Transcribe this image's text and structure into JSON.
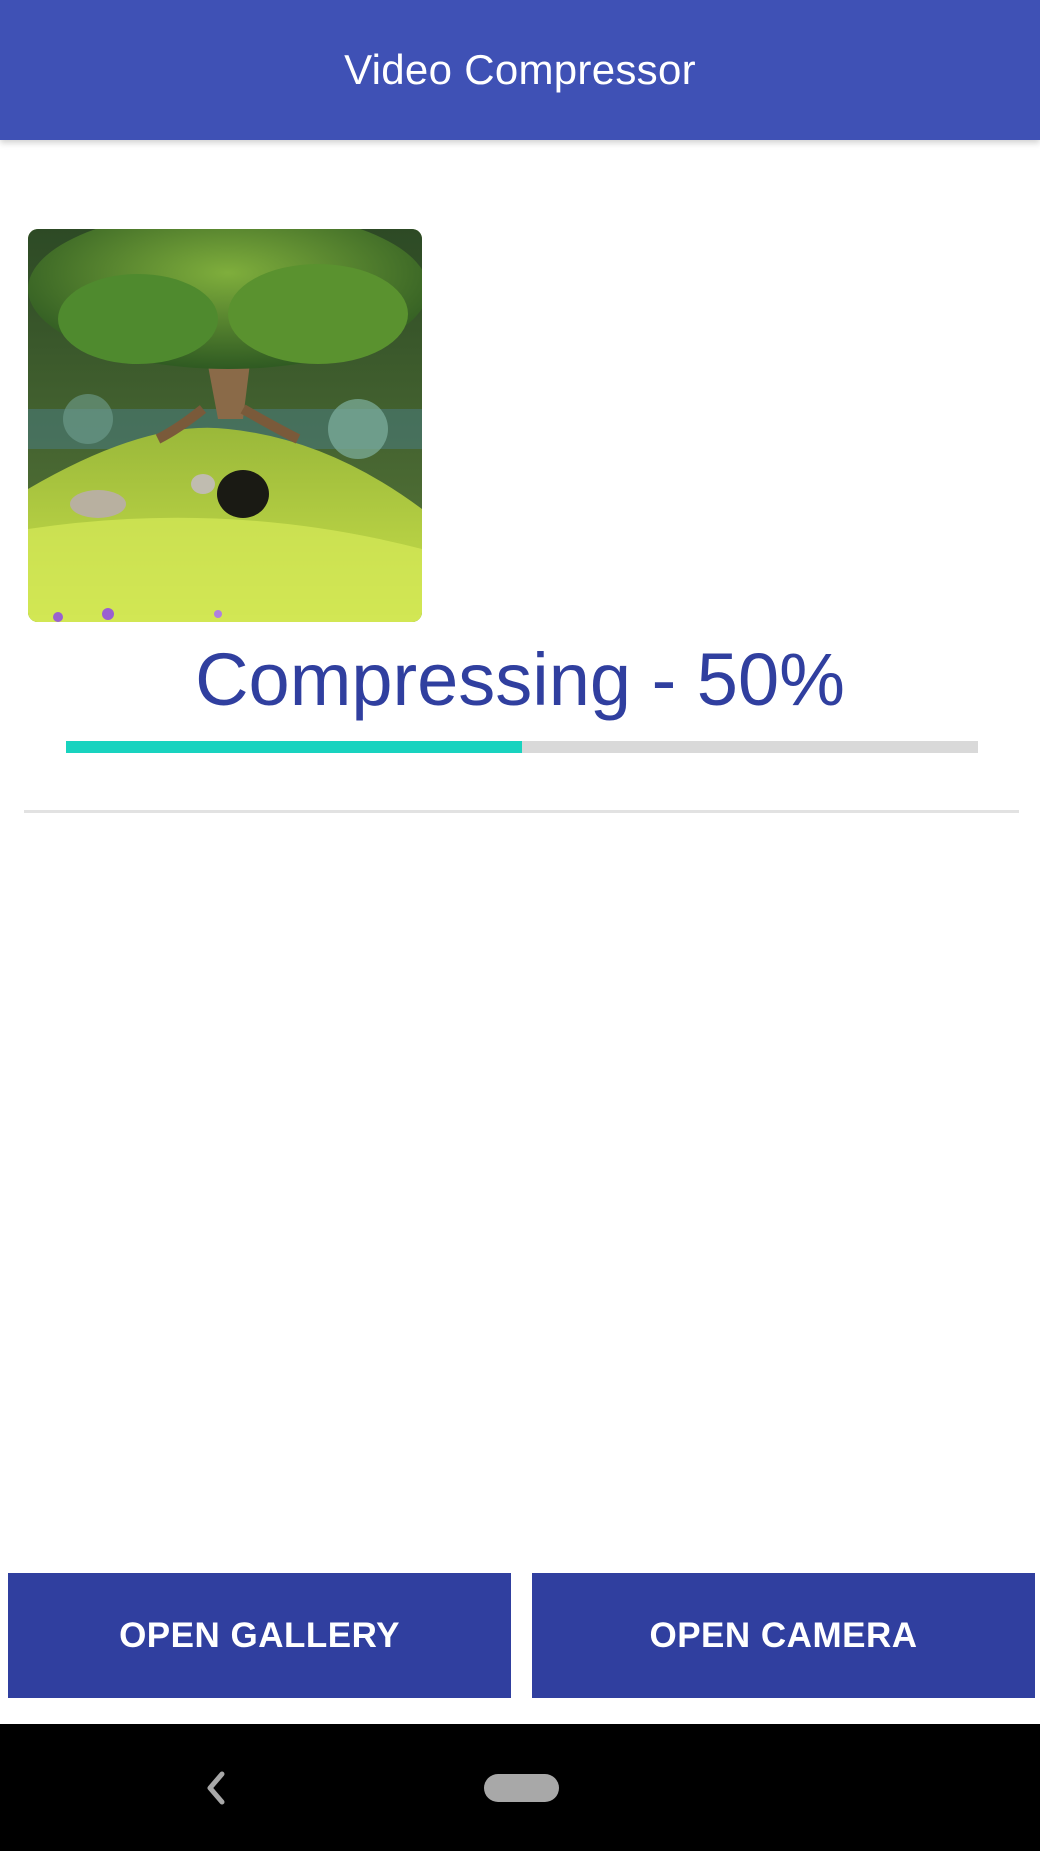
{
  "app": {
    "title": "Video Compressor"
  },
  "thumbnail": {
    "description_icon": "video-thumbnail"
  },
  "compression": {
    "status_text": "Compressing - 50%",
    "progress_percent": 50
  },
  "buttons": {
    "gallery_label": "OPEN GALLERY",
    "camera_label": "OPEN CAMERA"
  },
  "navigation": {
    "back_icon": "back-chevron-icon",
    "home_icon": "home-pill-icon"
  },
  "colors": {
    "app_bar": "#3f51b5",
    "primary_dark": "#303f9f",
    "progress_fill": "#18d3bf",
    "progress_track": "#d9d9d9"
  }
}
